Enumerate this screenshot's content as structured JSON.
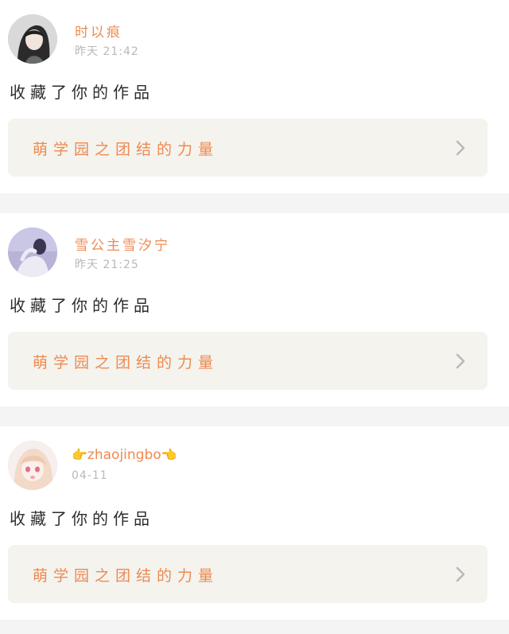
{
  "notifications": [
    {
      "user_name": "时以痕",
      "time": "昨天 21:42",
      "action_text": "收藏了你的作品",
      "work_title": "萌学园之团结的力量",
      "avatar_icon": "avatar-dark-hair-girl"
    },
    {
      "user_name": "雪公主雪汐宁",
      "time": "昨天 21:25",
      "action_text": "收藏了你的作品",
      "work_title": "萌学园之团结的力量",
      "avatar_icon": "avatar-girl-lavender-sky"
    },
    {
      "user_name_prefix_emoji": "👉",
      "user_name": "zhaojingbo",
      "user_name_suffix_emoji": "👈",
      "time": "04-11",
      "action_text": "收藏了你的作品",
      "work_title": "萌学园之团结的力量",
      "avatar_icon": "avatar-anime-pink-hair"
    }
  ],
  "colors": {
    "accent": "#ee8a50",
    "timestamp": "#b9b9b9",
    "card_link_bg": "#f4f3ee",
    "divider": "#f5f4f4"
  }
}
